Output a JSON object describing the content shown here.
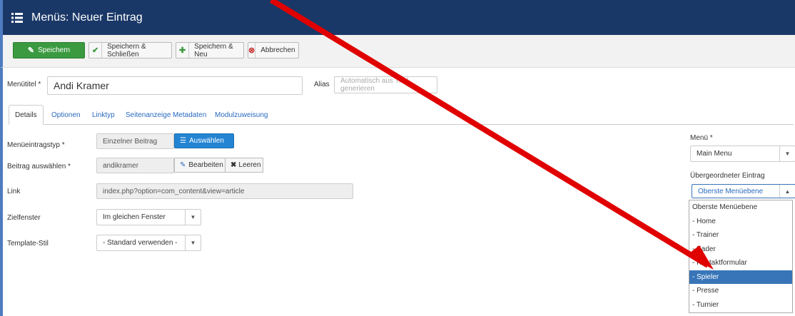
{
  "header": {
    "title": "Menüs: Neuer Eintrag"
  },
  "toolbar": {
    "save": "Speichern",
    "save_close": "Speichern & Schließen",
    "save_new": "Speichern & Neu",
    "cancel": "Abbrechen"
  },
  "form": {
    "menutitle_label": "Menütitel *",
    "menutitle_value": "Andi Kramer",
    "alias_label": "Alias",
    "alias_placeholder": "Automatisch aus Titel generieren"
  },
  "tabs": [
    "Details",
    "Optionen",
    "Linktyp",
    "Seitenanzeige",
    "Metadaten",
    "Modulzuweisung"
  ],
  "details": {
    "type_label": "Menüeintragstyp *",
    "type_value": "Einzelner Beitrag",
    "select_button": "Auswählen",
    "article_label": "Beitrag auswählen *",
    "article_value": "andikramer",
    "edit_button": "Bearbeiten",
    "clear_button": "Leeren",
    "link_label": "Link",
    "link_value": "index.php?option=com_content&view=article",
    "target_label": "Zielfenster",
    "target_value": "Im gleichen Fenster",
    "template_label": "Template-Stil",
    "template_value": "- Standard verwenden -"
  },
  "sidebar": {
    "menu_label": "Menü *",
    "menu_value": "Main Menu",
    "parent_label": "Übergeordneter Eintrag",
    "parent_value": "Oberste Menüebene",
    "parent_options": [
      "Oberste Menüebene",
      "- Home",
      "- Trainer",
      "- Kader",
      "- Kontaktformular",
      "- Spieler",
      "- Presse",
      "- Turnier"
    ],
    "selected_index": 5
  },
  "colors": {
    "header_bg": "#1a3867",
    "save_green": "#3b9a40",
    "accent_blue": "#2384d3",
    "selected_blue": "#3875b8",
    "arrow_red": "#e00000"
  }
}
